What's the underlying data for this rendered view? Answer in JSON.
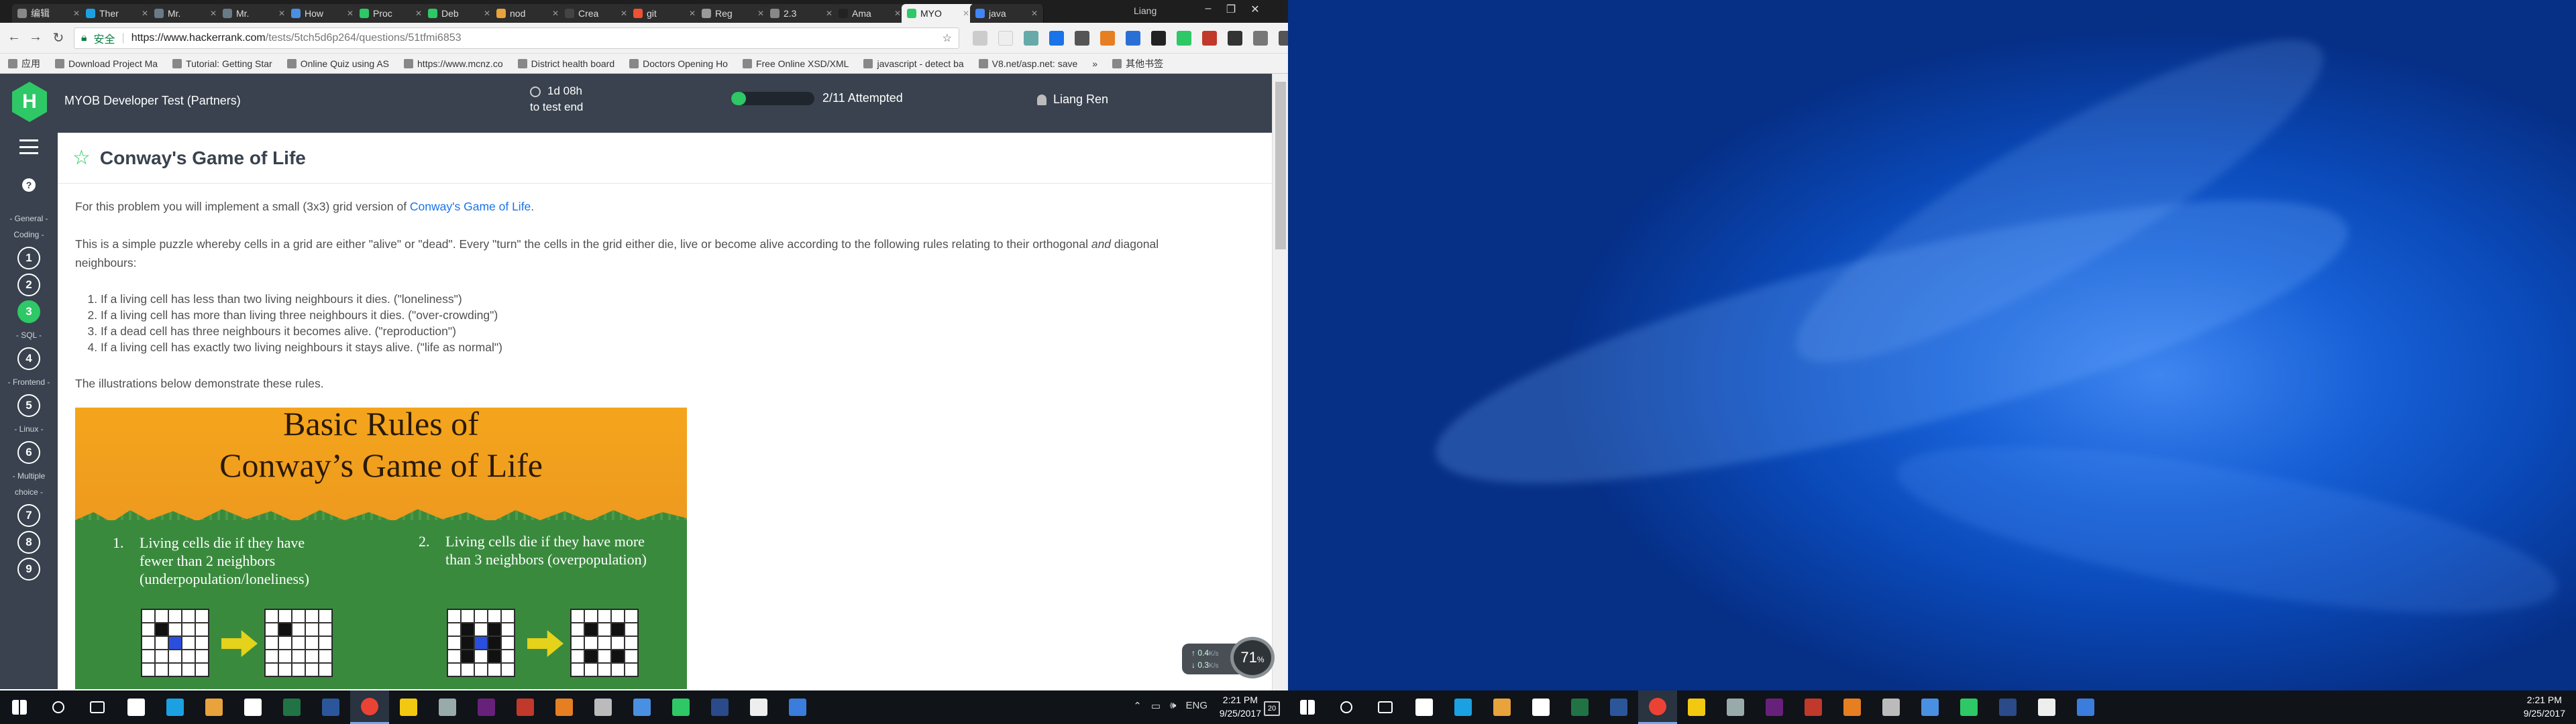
{
  "browser": {
    "tabs": [
      {
        "label": "编辑",
        "color": "#888"
      },
      {
        "label": "Ther",
        "color": "#1ba1e2"
      },
      {
        "label": "Mr.",
        "color": "#6a7b88"
      },
      {
        "label": "Mr.",
        "color": "#6a7b88"
      },
      {
        "label": "How",
        "color": "#4a90e2"
      },
      {
        "label": "Proc",
        "color": "#2ec866"
      },
      {
        "label": "Deb",
        "color": "#2ec866"
      },
      {
        "label": "nod",
        "color": "#e8a33d"
      },
      {
        "label": "Crea",
        "color": "#444"
      },
      {
        "label": "git",
        "color": "#f05133"
      },
      {
        "label": "Reg",
        "color": "#999"
      },
      {
        "label": "2.3",
        "color": "#888"
      },
      {
        "label": "Ama",
        "color": "#222"
      },
      {
        "label": "MYO",
        "color": "#2ec866",
        "active": true
      },
      {
        "label": "java",
        "color": "#4285f4"
      }
    ],
    "window_user": "Liang",
    "secure_label": "安全",
    "url_host": "https://www.hackerrank.com",
    "url_path": "/tests/5tch5d6p264/questions/51tfmi6853",
    "bookmarks": [
      "应用",
      "Download Project Ma",
      "Tutorial: Getting Star",
      "Online Quiz using AS",
      "https://www.mcnz.co",
      "District health board",
      "Doctors Opening Ho",
      "Free Online XSD/XML",
      "javascript - detect ba",
      "V8.net/asp.net: save",
      "»",
      "其他书签"
    ]
  },
  "header": {
    "logo": "H",
    "test_name": "MYOB Developer Test (Partners)",
    "time_remaining": "1d 08h",
    "time_suffix": "to test end",
    "progress_label": "2/11 Attempted",
    "progress_fraction": 0.18,
    "user_name": "Liang Ren"
  },
  "sidebar": {
    "sections": [
      {
        "label": "- General -",
        "questions": []
      },
      {
        "label": "Coding -",
        "questions": [
          "1",
          "2",
          "3"
        ]
      },
      {
        "label": "- SQL -",
        "questions": [
          "4"
        ]
      },
      {
        "label": "- Frontend -",
        "questions": [
          "5"
        ]
      },
      {
        "label": "- Linux -",
        "questions": [
          "6"
        ]
      },
      {
        "label": "- Multiple choice -",
        "questions": [
          "7",
          "8",
          "9"
        ]
      }
    ],
    "current_question": "3"
  },
  "question": {
    "title": "Conway's Game of Life",
    "intro_before": "For this problem you will implement a small (3x3) grid version of ",
    "intro_link": "Conway's Game of Life",
    "intro_after": ".",
    "para2_a": "This is a simple puzzle whereby cells in a grid are either \"alive\" or \"dead\". Every \"turn\" the cells in the grid either die, live or become alive according to the following rules relating to their orthogonal ",
    "para2_em": "and",
    "para2_b": " diagonal neighbours:",
    "rules": [
      "If a living cell has less than two living neighbours it dies. (\"loneliness\")",
      "If a living cell has more than living three neighbours it dies. (\"over-crowding\")",
      "If a dead cell has three neighbours it becomes alive. (\"reproduction\")",
      "If a living cell has exactly two living neighbours it stays alive. (\"life as normal\")"
    ],
    "illus_intro": "The illustrations below demonstrate these rules.",
    "illustration": {
      "title_line1": "Basic Rules of",
      "title_line2": "Conway’s Game of Life",
      "rule1_num": "1.",
      "rule1_text": "Living cells die if they have fewer than 2 neighbors (underpopulation/loneliness)",
      "rule2_num": "2.",
      "rule2_text": "Living cells die if they have more than 3 neighbors (overpopulation)"
    }
  },
  "net_meter": {
    "up": "0.4",
    "down": "0.3",
    "unit": "K/s",
    "percent": "71",
    "percent_sign": "%"
  },
  "taskbar": {
    "time": "2:21 PM",
    "date": "9/25/2017",
    "lang": "ENG",
    "notifications": "20"
  }
}
